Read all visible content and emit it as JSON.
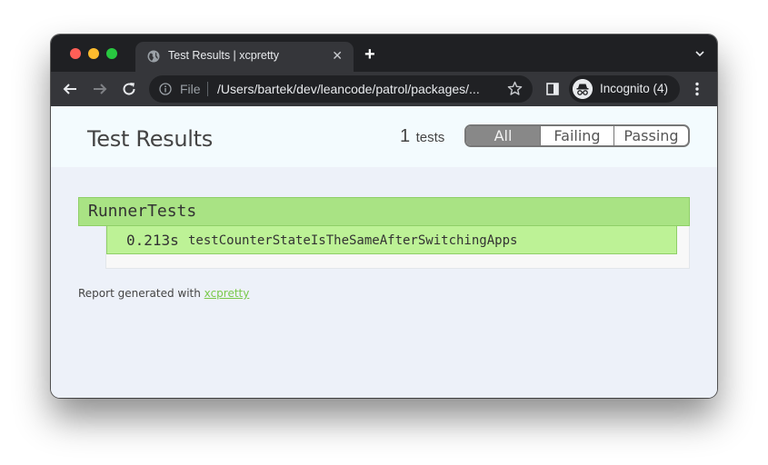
{
  "browser": {
    "tab": {
      "title": "Test Results | xcpretty",
      "favicon": "globe-icon"
    },
    "new_tab_symbol": "+",
    "close_symbol": "✕",
    "omnibox": {
      "scheme_label": "File",
      "url": "/Users/bartek/dev/leancode/patrol/packages/..."
    },
    "profile": {
      "label": "Incognito (4)",
      "icon": "incognito-icon"
    }
  },
  "page": {
    "title": "Test Results",
    "test_count": {
      "number": "1",
      "label": "tests"
    },
    "filters": [
      {
        "label": "All",
        "selected": true
      },
      {
        "label": "Failing",
        "selected": false
      },
      {
        "label": "Passing",
        "selected": false
      }
    ],
    "suites": [
      {
        "name": "RunnerTests",
        "tests": [
          {
            "time": "0.213s",
            "name": "testCounterStateIsTheSameAfterSwitchingApps",
            "status": "passing"
          }
        ]
      }
    ],
    "footer": {
      "text": "Report generated with ",
      "link_label": "xcpretty"
    }
  },
  "colors": {
    "pass_header": "#a9e384",
    "pass_row": "#bdf296",
    "link": "#79c94a",
    "filter_selected": "#888888"
  }
}
